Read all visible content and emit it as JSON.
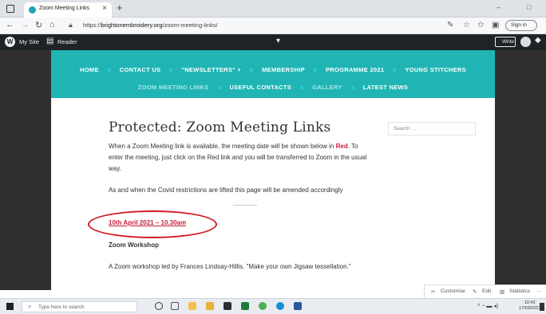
{
  "browser": {
    "tab_title": "Zoom Meeting Links",
    "tab_close": "×",
    "new_tab": "+",
    "url_prefix": "https://",
    "url_domain": "brightonembroidery.org",
    "url_path": "/zoom-meeting-links/",
    "sign_in": "Sign in",
    "minimize": "–",
    "maximize": "□"
  },
  "wp_admin_bar": {
    "my_site": "My Site",
    "reader": "Reader",
    "write": "Write"
  },
  "menu": {
    "row1": [
      "HOME",
      "CONTACT US",
      "\"NEWSLETTERS\" +",
      "MEMBERSHIP",
      "PROGRAMME 2021",
      "YOUNG STITCHERS"
    ],
    "row2": [
      {
        "label": "ZOOM MEETING LINKS",
        "dim": true
      },
      {
        "label": "USEFUL CONTACTS",
        "dim": false
      },
      {
        "label": "GALLERY",
        "dim": true
      },
      {
        "label": "LATEST NEWS",
        "dim": false
      }
    ]
  },
  "content": {
    "title": "Protected: Zoom Meeting Links",
    "para1_before": "When a Zoom Meeting link is available, the meeting date will be shown below in ",
    "para1_red": "Red",
    "para1_after": ". To enter the meeting, just click on the Red link and you will be transferred to Zoom in the usual way.",
    "para2": "As and when the Covid restrictions are lifted this page will be amended accordingly",
    "meeting_link": "10th April 2021  –  10.30am",
    "workshop_title": "Zoom Workshop",
    "workshop_desc": "A Zoom workshop led by Frances Lindsay-Hillis. \"Make your own Jigsaw tessellation.\""
  },
  "sidebar": {
    "search_placeholder": "Search …"
  },
  "customizer": {
    "customise": "Customise",
    "edit": "Edit",
    "statistics": "Statistics",
    "more": "···"
  },
  "taskbar": {
    "search_placeholder": "Type here to search",
    "time": "10:42",
    "date": "17/03/2021"
  },
  "colors": {
    "menu_teal": "#20b5b4",
    "link_red": "#c41e3a",
    "annotation_red": "#d31721",
    "wp_bar": "#1d2327"
  }
}
